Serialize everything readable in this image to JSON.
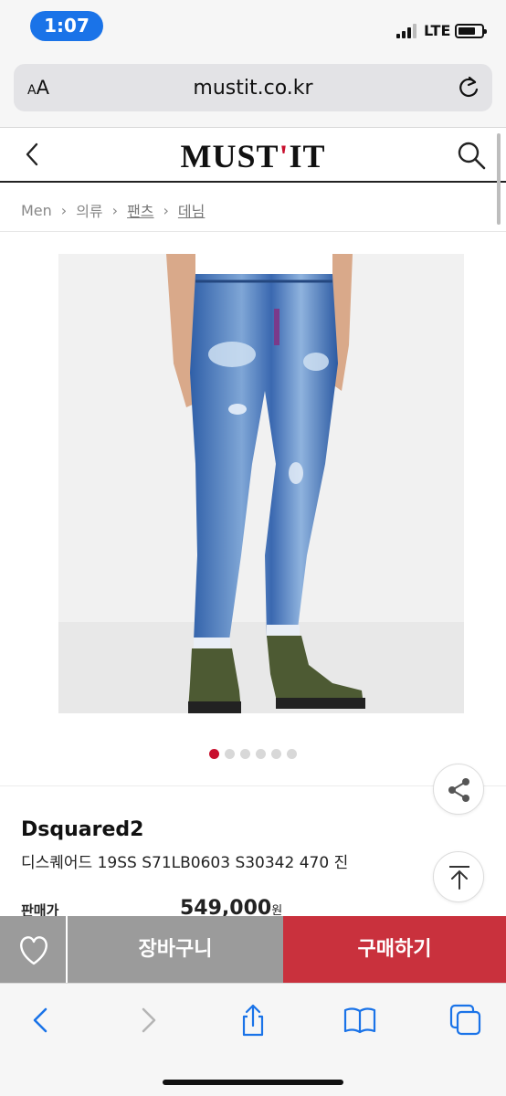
{
  "status_bar": {
    "time": "1:07",
    "network": "LTE",
    "battery_level": 0.75
  },
  "browser": {
    "text_size_label_small": "A",
    "text_size_label_large": "A",
    "url": "mustit.co.kr"
  },
  "site": {
    "logo_left": "MUST",
    "logo_apostrophe": "'",
    "logo_right": "IT",
    "brand_color": "#c8102e"
  },
  "breadcrumb": [
    "Men",
    "의류",
    "팬츠",
    "데님"
  ],
  "carousel": {
    "total": 6,
    "active_index": 0
  },
  "product": {
    "brand": "Dsquared2",
    "name": "디스퀘어드 19SS S71LB0603 S30342 470 진",
    "price_label": "판매가",
    "price": "549,000",
    "currency": "원"
  },
  "actions": {
    "cart_label": "장바구니",
    "buy_label": "구매하기",
    "buy_color": "#c9313d",
    "cart_color": "#9b9b9b"
  },
  "icons": {
    "reload": "reload-icon",
    "back": "chevron-left-icon",
    "search": "search-icon",
    "share": "share-icon",
    "scroll_top": "arrow-up-to-top-icon",
    "wishlist": "heart-icon",
    "tabs": "tabs-icon",
    "bookmarks": "book-icon"
  }
}
